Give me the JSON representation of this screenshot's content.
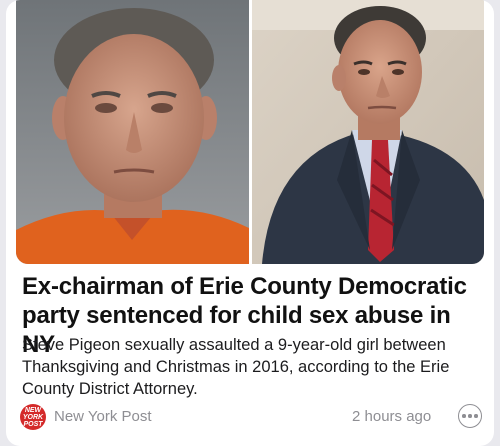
{
  "article": {
    "headline": "Ex-chairman of Erie County Democratic party sentenced for child sex abuse in NY",
    "summary": "Steve Pigeon sexually assaulted a 9-year-old girl between Thanksgiving and Christmas in 2016, according to the Erie County District Attorney.",
    "images": [
      {
        "icon": "mugshot-photo"
      },
      {
        "icon": "courtroom-photo"
      }
    ]
  },
  "footer": {
    "publisher_logo_text": "NEW YORK POST",
    "publisher": "New York Post",
    "timestamp": "2 hours ago",
    "more_icon": "ellipsis-circle-icon"
  },
  "colors": {
    "background": "#e9e9ee",
    "card": "#ffffff",
    "meta_text": "#8e8e93",
    "logo_red": "#d42a2a"
  }
}
